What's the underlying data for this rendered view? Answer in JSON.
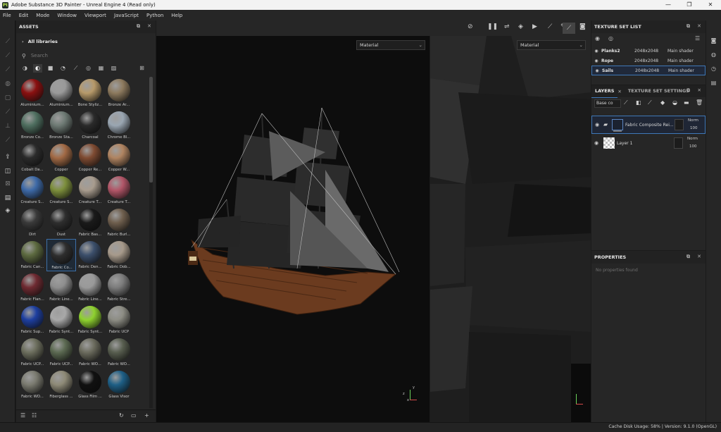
{
  "titlebar": {
    "icon_text": "Pt",
    "title": "Adobe Substance 3D Painter - Unreal Engine 4 (Read only)",
    "controls": [
      "—",
      "❐",
      "✕"
    ]
  },
  "menu": [
    "File",
    "Edit",
    "Mode",
    "Window",
    "Viewport",
    "JavaScript",
    "Python",
    "Help"
  ],
  "assets": {
    "title": "ASSETS",
    "library": "All libraries",
    "search_placeholder": "Search",
    "thumbnails": [
      {
        "label": "Aluminium...",
        "color": "#8a1010"
      },
      {
        "label": "Aluminium...",
        "color": "#9a9a9a"
      },
      {
        "label": "Bone Styliz...",
        "color": "#b79a6a"
      },
      {
        "label": "Bronze Ar...",
        "color": "#8d7a5e"
      },
      {
        "label": "Bronze Co...",
        "color": "#4f6f60"
      },
      {
        "label": "Bronze Sta...",
        "color": "#6e7a74"
      },
      {
        "label": "Charcoal",
        "color": "#2a2a2a"
      },
      {
        "label": "Chrome Bl...",
        "color": "#9aa6b2"
      },
      {
        "label": "Cobalt Da...",
        "color": "#2b2b2b"
      },
      {
        "label": "Copper",
        "color": "#a26a45"
      },
      {
        "label": "Copper Re...",
        "color": "#7f4b32"
      },
      {
        "label": "Copper W...",
        "color": "#b08461"
      },
      {
        "label": "Creature S...",
        "color": "#3e6aa8"
      },
      {
        "label": "Creature S...",
        "color": "#7d8f3c"
      },
      {
        "label": "Creature T...",
        "color": "#a89c8e"
      },
      {
        "label": "Creature T...",
        "color": "#b25668"
      },
      {
        "label": "Dirt",
        "color": "#3a3a3a"
      },
      {
        "label": "Dust",
        "color": "#2e2e2e"
      },
      {
        "label": "Fabric Bas...",
        "color": "#1a1a1a"
      },
      {
        "label": "Fabric Burl...",
        "color": "#6f5f4e"
      },
      {
        "label": "Fabric Can...",
        "color": "#5d6a40"
      },
      {
        "label": "Fabric Co...",
        "color": "#2e2e2e"
      },
      {
        "label": "Fabric Den...",
        "color": "#3c4f6b"
      },
      {
        "label": "Fabric Dob...",
        "color": "#a79a8b"
      },
      {
        "label": "Fabric Flan...",
        "color": "#6e2a31"
      },
      {
        "label": "Fabric Line...",
        "color": "#8e8e8e"
      },
      {
        "label": "Fabric Line...",
        "color": "#9a9a9a"
      },
      {
        "label": "Fabric Stre...",
        "color": "#7c7c7c"
      },
      {
        "label": "Fabric Sup...",
        "color": "#1e3fa0"
      },
      {
        "label": "Fabric Synt...",
        "color": "#a8a8a8"
      },
      {
        "label": "Fabric Synt...",
        "color": "#8fd22f"
      },
      {
        "label": "Fabric UCP",
        "color": "#8d8d84"
      },
      {
        "label": "Fabric UCP...",
        "color": "#6d6f5e"
      },
      {
        "label": "Fabric UCP...",
        "color": "#5c6a52"
      },
      {
        "label": "Fabric WO...",
        "color": "#6c6c5e"
      },
      {
        "label": "Fabric WO...",
        "color": "#585e4f"
      },
      {
        "label": "Fabric WO...",
        "color": "#7b7b70"
      },
      {
        "label": "Fiberglass ...",
        "color": "#8e8a77"
      },
      {
        "label": "Glass Film ...",
        "color": "#111111"
      },
      {
        "label": "Glass Visor",
        "color": "#1e5f86"
      }
    ]
  },
  "viewport": {
    "left_channel": "Material",
    "right_channel": "Material"
  },
  "texture_set_list": {
    "title": "TEXTURE SET LIST",
    "rows": [
      {
        "name": "Planks2",
        "size": "2048x2048",
        "shader": "Main shader"
      },
      {
        "name": "Rope",
        "size": "2048x2048",
        "shader": "Main shader"
      },
      {
        "name": "Sails",
        "size": "2048x2048",
        "shader": "Main shader"
      }
    ]
  },
  "layers": {
    "tab_layers": "LAYERS",
    "tab_settings": "TEXTURE SET SETTINGS",
    "channel": "Base co",
    "items": [
      {
        "name": "Fabric Composite Rei...",
        "blend": "Norm",
        "opacity": "100"
      },
      {
        "name": "Layer 1",
        "blend": "Norm",
        "opacity": "100"
      }
    ]
  },
  "properties": {
    "title": "PROPERTIES",
    "empty_text": "No properties found"
  },
  "status": {
    "text": "Cache Disk Usage:    58% | Version: 9.1.0 (OpenGL)"
  },
  "axes": {
    "x": "x",
    "y": "y",
    "z": "z"
  },
  "colors": {
    "accent": "#3f78b8",
    "panel": "#262626",
    "viewport": "#0d0d0d"
  }
}
